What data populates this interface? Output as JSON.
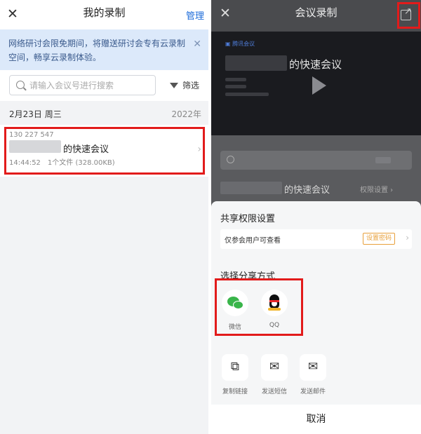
{
  "left": {
    "title": "我的录制",
    "manage_label": "管理",
    "close_label": "✕",
    "notice": "网络研讨会限免期间，将赠送研讨会专有云录制空间，畅享云录制体验。",
    "notice_close": "✕",
    "search_placeholder": "请输入会议号进行搜索",
    "filter_label": "筛选",
    "date_label": "2月23日 周三",
    "year_label": "2022年",
    "recording": {
      "meeting_id": "130 227 547",
      "name_suffix": "的快速会议",
      "time": "14:44:52",
      "files": "1个文件 (328.00KB)",
      "arrow": "›"
    }
  },
  "right": {
    "title": "会议录制",
    "close_label": "✕",
    "share_arrow": "↗",
    "video": {
      "brand": "▣ 腾讯会议",
      "title_suffix": "的快速会议"
    },
    "list_name_suffix": "的快速会议",
    "list_perm": "权限设置 ›",
    "sheet": {
      "permission_heading": "共享权限设置",
      "permission_text": "仅参会用户可查看",
      "permission_badge": "设置密码",
      "permission_arrow": "›",
      "share_heading": "选择分享方式",
      "options_primary": [
        {
          "label": "微信",
          "icon": "wechat-icon"
        },
        {
          "label": "QQ",
          "icon": "qq-icon"
        }
      ],
      "options_secondary": [
        {
          "label": "复制链接",
          "icon": "copy-link-icon",
          "glyph": "⧉"
        },
        {
          "label": "发送短信",
          "icon": "sms-icon",
          "glyph": "✉"
        },
        {
          "label": "发送邮件",
          "icon": "mail-icon",
          "glyph": "✉"
        }
      ],
      "cancel_label": "取消"
    }
  },
  "colors": {
    "accent": "#1a6ad9",
    "highlight": "#e21b1b",
    "badge": "#e8a03b",
    "wechat": "#39b54a"
  }
}
